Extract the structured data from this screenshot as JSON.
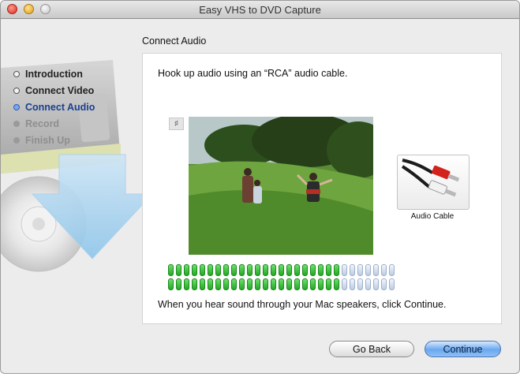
{
  "window": {
    "title": "Easy VHS to DVD Capture"
  },
  "sidebar": {
    "steps": [
      {
        "label": "Introduction",
        "state": "done"
      },
      {
        "label": "Connect Video",
        "state": "done"
      },
      {
        "label": "Connect Audio",
        "state": "current"
      },
      {
        "label": "Record",
        "state": "upcoming"
      },
      {
        "label": "Finish Up",
        "state": "upcoming"
      }
    ]
  },
  "main": {
    "section_title": "Connect Audio",
    "instruction": "Hook up audio using an “RCA” audio cable.",
    "audio_indicator_icon": "speaker-icon",
    "cable_button": {
      "label": "Audio Cable",
      "icon": "rca-cable-icon"
    },
    "audio_level": {
      "rows": 2,
      "segments_total": 29,
      "segments_active": 22,
      "active_color": "#2fb82f",
      "inactive_color": "#b9c8de"
    },
    "footer_text": "When you hear sound through your Mac speakers, click Continue."
  },
  "buttons": {
    "back_label": "Go Back",
    "continue_label": "Continue"
  },
  "colors": {
    "accent": "#6aa7ee",
    "current_step": "#1b3f8f"
  }
}
